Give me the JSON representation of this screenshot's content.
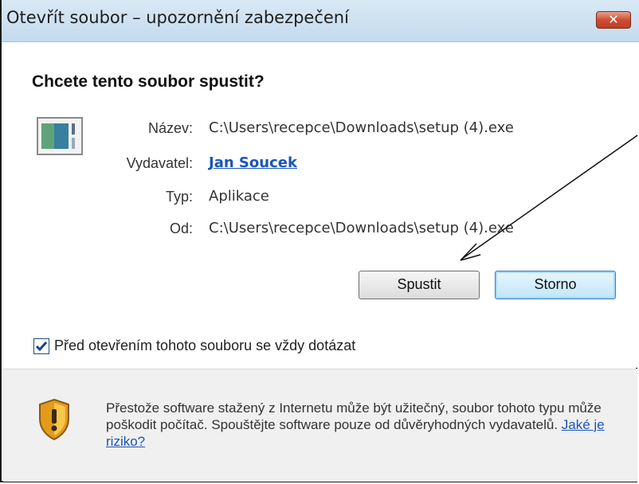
{
  "window": {
    "title": "Otevřít soubor – upozornění zabezpečení",
    "close_glyph": "✕"
  },
  "main": {
    "heading": "Chcete tento soubor spustit?",
    "fields": {
      "name_label": "Název:",
      "name_value": "C:\\Users\\recepce\\Downloads\\setup (4).exe",
      "publisher_label": "Vydavatel:",
      "publisher_value": "Jan Soucek",
      "type_label": "Typ:",
      "type_value": "Aplikace",
      "from_label": "Od:",
      "from_value": "C:\\Users\\recepce\\Downloads\\setup (4).exe"
    },
    "buttons": {
      "run": "Spustit",
      "cancel": "Storno"
    },
    "checkbox": {
      "label": "Před otevřením tohoto souboru se vždy dotázat",
      "checked": true
    }
  },
  "footer": {
    "warning_text": "Přestože software stažený z Internetu může být užitečný, soubor tohoto typu může poškodit počítač. Spouštějte software pouze od důvěryhodných vydavatelů.",
    "risk_link": "Jaké je riziko?"
  },
  "colors": {
    "link": "#1a56b8",
    "titlebar": "#c4dbee",
    "close_button": "#c94a2f"
  },
  "icons": {
    "file": "application-file-icon",
    "shield": "warning-shield-icon",
    "close": "close-icon"
  }
}
